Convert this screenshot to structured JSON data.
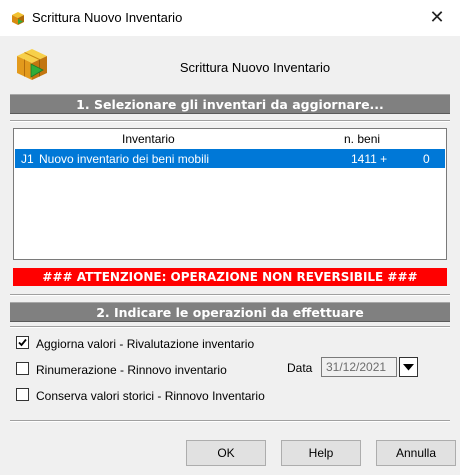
{
  "window": {
    "title": "Scrittura Nuovo Inventario",
    "close_glyph": "✕"
  },
  "header": {
    "title": "Scrittura Nuovo Inventario",
    "icon": "package-cube-icon"
  },
  "section1": {
    "title": "1. Selezionare gli inventari da aggiornare..."
  },
  "inventory_list": {
    "columns": [
      "Inventario",
      "n. beni"
    ],
    "rows": [
      {
        "code": "J1",
        "name": "Nuovo inventario dei beni mobili",
        "count": "1411 +",
        "extra": "0",
        "selected": true
      }
    ],
    "selection_color": "#0078d7"
  },
  "warning": {
    "text": "### ATTENZIONE: OPERAZIONE NON REVERSIBILE ###",
    "color": "#ff0000"
  },
  "section2": {
    "title": "2. Indicare le operazioni da effettuare"
  },
  "options": [
    {
      "label": "Aggiorna valori - Rivalutazione inventario",
      "checked": true
    },
    {
      "label": "Rinumerazione - Rinnovo inventario",
      "checked": false
    },
    {
      "label": "Conserva valori storici - Rinnovo Inventario",
      "checked": false
    }
  ],
  "date": {
    "label": "Data",
    "value": "31/12/2021"
  },
  "buttons": {
    "ok": "OK",
    "help": "Help",
    "cancel": "Annulla"
  }
}
